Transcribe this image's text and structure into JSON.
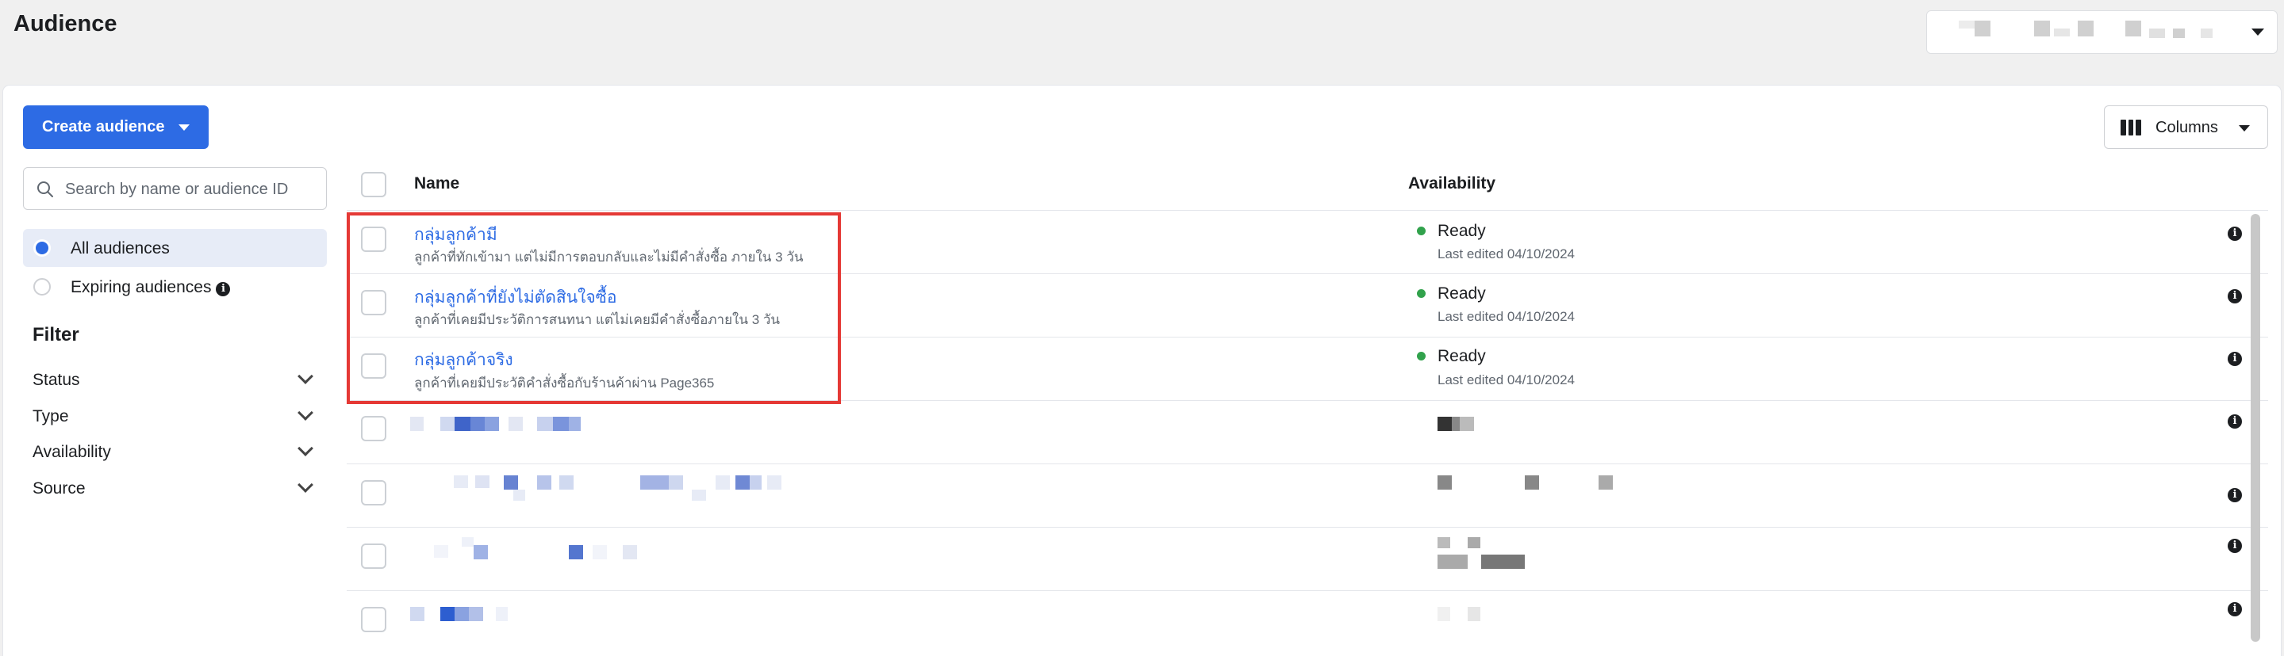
{
  "header": {
    "title": "Audience"
  },
  "toolbar": {
    "create_label": "Create audience",
    "columns_label": "Columns"
  },
  "sidebar": {
    "search_placeholder": "Search by name or audience ID",
    "views": [
      {
        "label": "All audiences",
        "selected": true
      },
      {
        "label": "Expiring audiences",
        "selected": false
      }
    ],
    "filter_title": "Filter",
    "filters": [
      "Status",
      "Type",
      "Availability",
      "Source"
    ]
  },
  "table": {
    "columns": [
      "Name",
      "Availability"
    ],
    "rows": [
      {
        "name": "กลุ่มลูกค้ามี",
        "description": "ลูกค้าที่ทักเข้ามา แต่ไม่มีการตอบกลับและไม่มีคำสั่งซื้อ ภายใน 3 วัน",
        "status": "Ready",
        "edited": "Last edited 04/10/2024"
      },
      {
        "name": "กลุ่มลูกค้าที่ยังไม่ตัดสินใจซื้อ",
        "description": "ลูกค้าที่เคยมีประวัติการสนทนา แต่ไม่เคยมีคำสั่งซื้อภายใน 3 วัน",
        "status": "Ready",
        "edited": "Last edited 04/10/2024"
      },
      {
        "name": "กลุ่มลูกค้าจริง",
        "description": "ลูกค้าที่เคยมีประวัติคำสั่งซื้อกับร้านค้าผ่าน Page365",
        "status": "Ready",
        "edited": "Last edited 04/10/2024"
      }
    ]
  },
  "colors": {
    "accent": "#2d6be4",
    "ready": "#31a24c",
    "highlight": "#e53935"
  }
}
